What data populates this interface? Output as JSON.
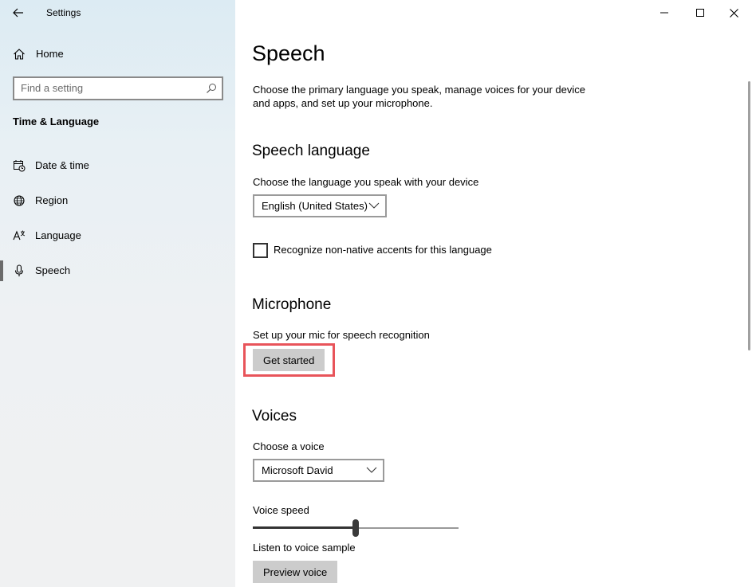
{
  "window": {
    "title": "Settings",
    "controls": [
      "minimize",
      "maximize",
      "close"
    ]
  },
  "sidebar": {
    "home_label": "Home",
    "search_placeholder": "Find a setting",
    "section_title": "Time & Language",
    "items": [
      {
        "label": "Date & time",
        "icon": "calendar-clock-icon",
        "active": false
      },
      {
        "label": "Region",
        "icon": "globe-icon",
        "active": false
      },
      {
        "label": "Language",
        "icon": "language-icon",
        "active": false
      },
      {
        "label": "Speech",
        "icon": "microphone-icon",
        "active": true
      }
    ]
  },
  "main": {
    "title": "Speech",
    "description": "Choose the primary language you speak, manage voices for your device and apps, and set up your microphone.",
    "speech_language": {
      "heading": "Speech language",
      "prompt": "Choose the language you speak with your device",
      "selected": "English (United States)",
      "checkbox_label": "Recognize non-native accents for this language",
      "checkbox_checked": false
    },
    "microphone": {
      "heading": "Microphone",
      "prompt": "Set up your mic for speech recognition",
      "button": "Get started"
    },
    "voices": {
      "heading": "Voices",
      "prompt": "Choose a voice",
      "selected": "Microsoft David",
      "speed_label": "Voice speed",
      "speed_fraction": 0.5,
      "sample_label": "Listen to voice sample",
      "preview_button": "Preview voice"
    }
  },
  "colors": {
    "highlight_border": "#e8545a",
    "button_bg": "#cccccc",
    "active_indicator": "#6b6b6b"
  }
}
